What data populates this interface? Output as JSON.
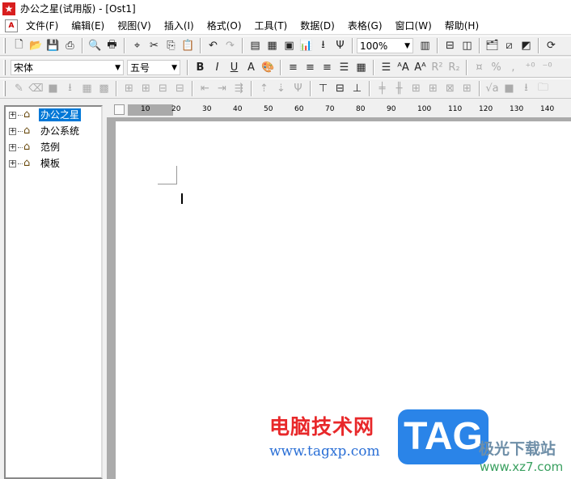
{
  "window": {
    "title": "办公之星(试用版) - [Ost1]"
  },
  "menu": [
    "文件(F)",
    "编辑(E)",
    "视图(V)",
    "插入(I)",
    "格式(O)",
    "工具(T)",
    "数据(D)",
    "表格(G)",
    "窗口(W)",
    "帮助(H)"
  ],
  "toolbar1": [
    {
      "n": "new-icon",
      "g": "🗋"
    },
    {
      "n": "open-icon",
      "g": "📂"
    },
    {
      "n": "save-icon",
      "g": "💾"
    },
    {
      "n": "print-setup-icon",
      "g": "⎙"
    },
    "|",
    {
      "n": "print-preview-icon",
      "g": "🔍"
    },
    {
      "n": "print-icon",
      "g": "🖶"
    },
    "|",
    {
      "n": "find-icon",
      "g": "⌖"
    },
    {
      "n": "cut-icon",
      "g": "✂"
    },
    {
      "n": "copy-icon",
      "g": "⎘"
    },
    {
      "n": "paste-icon",
      "g": "📋"
    },
    "|",
    {
      "n": "undo-icon",
      "g": "↶"
    },
    {
      "n": "redo-icon",
      "g": "↷",
      "d": 1
    },
    "|",
    {
      "n": "text-frame-icon",
      "g": "▤"
    },
    {
      "n": "insert-table-icon",
      "g": "▦"
    },
    {
      "n": "insert-image-icon",
      "g": "▣"
    },
    {
      "n": "insert-chart-icon",
      "g": "📊"
    },
    {
      "n": "dropdown-arrow-icon",
      "g": "⭳"
    },
    {
      "n": "symbol-icon",
      "g": "Ψ"
    },
    "|",
    {
      "combo": "zoom",
      "w": 70
    },
    {
      "n": "full-page-icon",
      "g": "▥"
    },
    "|",
    {
      "n": "split-horizontal-icon",
      "g": "⊟"
    },
    {
      "n": "split-vertical-icon",
      "g": "◫"
    },
    "|",
    {
      "n": "doc-browser-icon",
      "g": "🗂"
    },
    {
      "n": "edit-frame-icon",
      "g": "⧄"
    },
    {
      "n": "draw-icon",
      "g": "◩"
    },
    "|",
    {
      "n": "refresh-icon",
      "g": "⟳"
    }
  ],
  "toolbar2": [
    {
      "combo": "font",
      "w": 140
    },
    {
      "combo": "size",
      "w": 66
    },
    "|",
    {
      "n": "bold-icon",
      "g": "B"
    },
    {
      "n": "italic-icon",
      "g": "I"
    },
    {
      "n": "underline-icon",
      "g": "U"
    },
    {
      "n": "font-shade-icon",
      "g": "A"
    },
    {
      "n": "font-color-icon",
      "g": "🎨"
    },
    "|",
    {
      "n": "align-left-icon",
      "g": "≡"
    },
    {
      "n": "align-center-icon",
      "g": "≡"
    },
    {
      "n": "align-right-icon",
      "g": "≡"
    },
    {
      "n": "justify-icon",
      "g": "☰"
    },
    {
      "n": "distribute-icon",
      "g": "▦"
    },
    "|",
    {
      "n": "line-spacing-icon",
      "g": "☰"
    },
    {
      "n": "grow-font-icon",
      "g": "ᴬA"
    },
    {
      "n": "shrink-font-icon",
      "g": "Aᴬ"
    },
    {
      "n": "superscript-icon",
      "g": "R²",
      "d": 1
    },
    {
      "n": "subscript-icon",
      "g": "R₂",
      "d": 1
    },
    "|",
    {
      "n": "currency-icon",
      "g": "¤",
      "d": 1
    },
    {
      "n": "percent-icon",
      "g": "%",
      "d": 1
    },
    {
      "n": "comma-icon",
      "g": ",",
      "d": 1
    },
    {
      "n": "increase-decimal-icon",
      "g": "⁺⁰",
      "d": 1
    },
    {
      "n": "decrease-decimal-icon",
      "g": "⁻⁰",
      "d": 1
    }
  ],
  "toolbar3": [
    {
      "n": "pen-icon",
      "g": "✎",
      "d": 1
    },
    {
      "n": "eraser-icon",
      "g": "⌫",
      "d": 1
    },
    {
      "n": "cell-fill-icon",
      "g": "■",
      "d": 1
    },
    {
      "n": "dropdown-arrow-icon",
      "g": "⭳",
      "d": 1
    },
    {
      "n": "cell-border-icon",
      "g": "▦",
      "d": 1
    },
    {
      "n": "cell-grid-icon",
      "g": "▩",
      "d": 1
    },
    "|",
    {
      "n": "insert-row-icon",
      "g": "⊞",
      "d": 1
    },
    {
      "n": "insert-col-icon",
      "g": "⊞",
      "d": 1
    },
    {
      "n": "delete-row-icon",
      "g": "⊟",
      "d": 1
    },
    {
      "n": "delete-col-icon",
      "g": "⊟",
      "d": 1
    },
    "|",
    {
      "n": "merge-left-icon",
      "g": "⇤",
      "d": 1
    },
    {
      "n": "merge-right-icon",
      "g": "⇥",
      "d": 1
    },
    {
      "n": "merge-cells-icon",
      "g": "⇶",
      "d": 1
    },
    "|",
    {
      "n": "split-up-icon",
      "g": "⇡",
      "d": 1
    },
    {
      "n": "split-down-icon",
      "g": "⇣",
      "d": 1
    },
    {
      "n": "split-cell-icon",
      "g": "Ψ",
      "d": 1
    },
    "|",
    {
      "n": "align-top-icon",
      "g": "⊤"
    },
    {
      "n": "align-middle-icon",
      "g": "⊟"
    },
    {
      "n": "align-bottom-icon",
      "g": "⊥"
    },
    "|",
    {
      "n": "col-width-icon",
      "g": "╪",
      "d": 1
    },
    {
      "n": "row-height-icon",
      "g": "╫",
      "d": 1
    },
    {
      "n": "equal-width-icon",
      "g": "⊞",
      "d": 1
    },
    {
      "n": "equal-height-icon",
      "g": "⊞",
      "d": 1
    },
    {
      "n": "fit-width-icon",
      "g": "⊠",
      "d": 1
    },
    {
      "n": "fit-height-icon",
      "g": "⊞",
      "d": 1
    },
    "|",
    {
      "n": "formula-icon",
      "g": "√a",
      "d": 1
    },
    {
      "n": "fill-color-icon",
      "g": "■",
      "d": 1
    },
    {
      "n": "dropdown-arrow-icon",
      "g": "⭳",
      "d": 1
    },
    {
      "n": "folder-icon",
      "g": "🗀",
      "d": 1
    }
  ],
  "combos": {
    "font": "宋体",
    "size": "五号",
    "zoom": "100%"
  },
  "tree": [
    "办公之星",
    "办公系统",
    "范例",
    "模板"
  ],
  "ruler": [
    "10",
    "20",
    "30",
    "40",
    "50",
    "60",
    "70",
    "80",
    "90",
    "100",
    "110",
    "120",
    "130",
    "140"
  ],
  "watermark": {
    "site_cn": "电脑技术网",
    "site_url": "www.tagxp.com",
    "tag": "TAG",
    "site2_cn": "极光下载站",
    "site2_url": "www.xz7.com"
  }
}
